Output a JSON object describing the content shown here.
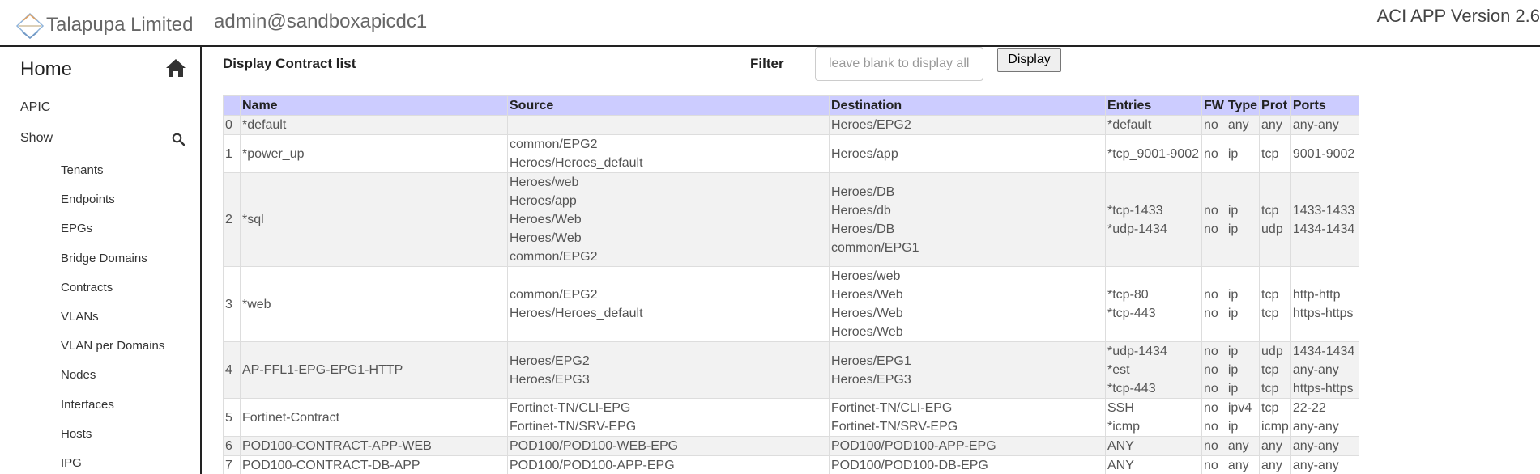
{
  "header": {
    "company": "Talapupa Limited",
    "user": "admin@sandboxapicdc1",
    "version": "ACI APP Version 2.6"
  },
  "sidebar": {
    "home": "Home",
    "apic": "APIC",
    "show": "Show",
    "items": [
      {
        "label": "Tenants"
      },
      {
        "label": "Endpoints"
      },
      {
        "label": "EPGs"
      },
      {
        "label": "Bridge Domains"
      },
      {
        "label": "Contracts"
      },
      {
        "label": "VLANs"
      },
      {
        "label": "VLAN per Domains"
      },
      {
        "label": "Nodes"
      },
      {
        "label": "Interfaces"
      },
      {
        "label": "Hosts"
      },
      {
        "label": "IPG"
      }
    ]
  },
  "main": {
    "title": "Display Contract list",
    "filter_label": "Filter",
    "filter_placeholder": "leave blank to display all",
    "filter_value": "",
    "display_button": "Display"
  },
  "table": {
    "headers": [
      "",
      "Name",
      "Source",
      "Destination",
      "Entries",
      "FW",
      "Type",
      "Prot",
      "Ports"
    ],
    "rows": [
      {
        "idx": "0",
        "name": "*default",
        "source": [],
        "destination": [
          "Heroes/EPG2"
        ],
        "entries": [
          "*default"
        ],
        "fw": [
          "no"
        ],
        "type": [
          "any"
        ],
        "prot": [
          "any"
        ],
        "ports": [
          "any-any"
        ]
      },
      {
        "idx": "1",
        "name": "*power_up",
        "source": [
          "common/EPG2",
          "Heroes/Heroes_default"
        ],
        "destination": [
          "Heroes/app"
        ],
        "entries": [
          "*tcp_9001-9002"
        ],
        "fw": [
          "no"
        ],
        "type": [
          "ip"
        ],
        "prot": [
          "tcp"
        ],
        "ports": [
          "9001-9002"
        ]
      },
      {
        "idx": "2",
        "name": "*sql",
        "source": [
          "Heroes/web",
          "Heroes/app",
          "Heroes/Web",
          "Heroes/Web",
          "common/EPG2"
        ],
        "destination": [
          "Heroes/DB",
          "Heroes/db",
          "Heroes/DB",
          "common/EPG1"
        ],
        "entries": [
          "*tcp-1433",
          "*udp-1434"
        ],
        "fw": [
          "no",
          "no"
        ],
        "type": [
          "ip",
          "ip"
        ],
        "prot": [
          "tcp",
          "udp"
        ],
        "ports": [
          "1433-1433",
          "1434-1434"
        ]
      },
      {
        "idx": "3",
        "name": "*web",
        "source": [
          "common/EPG2",
          "Heroes/Heroes_default"
        ],
        "destination": [
          "Heroes/web",
          "Heroes/Web",
          "Heroes/Web",
          "Heroes/Web"
        ],
        "entries": [
          "*tcp-80",
          "*tcp-443"
        ],
        "fw": [
          "no",
          "no"
        ],
        "type": [
          "ip",
          "ip"
        ],
        "prot": [
          "tcp",
          "tcp"
        ],
        "ports": [
          "http-http",
          "https-https"
        ]
      },
      {
        "idx": "4",
        "name": "AP-FFL1-EPG-EPG1-HTTP",
        "source": [
          "Heroes/EPG2",
          "Heroes/EPG3"
        ],
        "destination": [
          "Heroes/EPG1",
          "Heroes/EPG3"
        ],
        "entries": [
          "*udp-1434",
          "*est",
          "*tcp-443"
        ],
        "fw": [
          "no",
          "no",
          "no"
        ],
        "type": [
          "ip",
          "ip",
          "ip"
        ],
        "prot": [
          "udp",
          "tcp",
          "tcp"
        ],
        "ports": [
          "1434-1434",
          "any-any",
          "https-https"
        ]
      },
      {
        "idx": "5",
        "name": "Fortinet-Contract",
        "source": [
          "Fortinet-TN/CLI-EPG",
          "Fortinet-TN/SRV-EPG"
        ],
        "destination": [
          "Fortinet-TN/CLI-EPG",
          "Fortinet-TN/SRV-EPG"
        ],
        "entries": [
          "SSH",
          "*icmp"
        ],
        "fw": [
          "no",
          "no"
        ],
        "type": [
          "ipv4",
          "ip"
        ],
        "prot": [
          "tcp",
          "icmp"
        ],
        "ports": [
          "22-22",
          "any-any"
        ]
      },
      {
        "idx": "6",
        "name": "POD100-CONTRACT-APP-WEB",
        "source": [
          "POD100/POD100-WEB-EPG"
        ],
        "destination": [
          "POD100/POD100-APP-EPG"
        ],
        "entries": [
          "ANY"
        ],
        "fw": [
          "no"
        ],
        "type": [
          "any"
        ],
        "prot": [
          "any"
        ],
        "ports": [
          "any-any"
        ]
      },
      {
        "idx": "7",
        "name": "POD100-CONTRACT-DB-APP",
        "source": [
          "POD100/POD100-APP-EPG"
        ],
        "destination": [
          "POD100/POD100-DB-EPG"
        ],
        "entries": [
          "ANY"
        ],
        "fw": [
          "no"
        ],
        "type": [
          "any"
        ],
        "prot": [
          "any"
        ],
        "ports": [
          "any-any"
        ]
      }
    ]
  }
}
